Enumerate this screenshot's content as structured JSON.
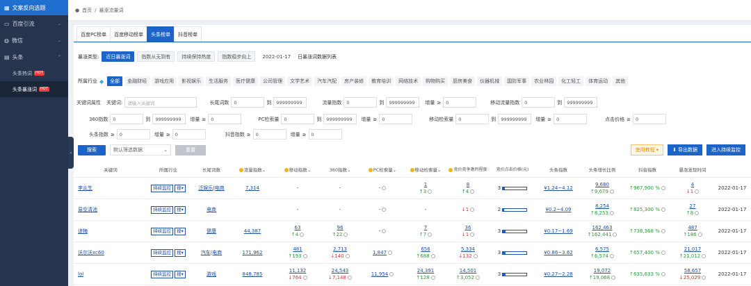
{
  "sidebar": {
    "title": "文案反向选题",
    "items": [
      {
        "label": "百度引流",
        "icon": "monitor-icon"
      },
      {
        "label": "微信",
        "icon": "wechat-icon"
      },
      {
        "label": "头条",
        "icon": "news-icon"
      }
    ],
    "subitems": [
      {
        "label": "头条热词",
        "badge": "HOT"
      },
      {
        "label": "头条暴涨词",
        "badge": "HOT"
      }
    ]
  },
  "breadcrumb": {
    "home": "首页",
    "sep": "/",
    "current": "暴涨流量词"
  },
  "tabs": [
    "百度PC榜单",
    "百度移动榜单",
    "头条榜单",
    "抖音榜单"
  ],
  "type_row": {
    "label": "暴涨类型:",
    "options": [
      "近日暴涨词",
      "指数从无到有",
      "持续保持热度",
      "指数稳步向上"
    ],
    "date": "2022-01-17",
    "date_suffix": "日暴涨词数据列表"
  },
  "industry": {
    "label": "所属行业",
    "items": [
      "全部",
      "金融财经",
      "游戏应用",
      "影视娱乐",
      "生活服务",
      "医疗健康",
      "公司管理",
      "文学艺术",
      "汽车汽配",
      "房产装修",
      "教育培训",
      "网络技术",
      "购物购买",
      "厨房美食",
      "仪器机械",
      "国防军事",
      "农业林园",
      "化工轻工",
      "体育运动",
      "其他"
    ]
  },
  "filters": {
    "kw_property": "关键词属性",
    "keyword_label": "关键词:",
    "keyword_ph": "请输入关键词",
    "to": "到",
    "ge": "≥",
    "long_tail": {
      "label": "长尾词数",
      "min": "0",
      "max": "999999999"
    },
    "traffic": {
      "label": "流量指数",
      "min": "0",
      "max": "999999999"
    },
    "traffic_inc": {
      "label": "增量",
      "value": "0"
    },
    "mobile_traffic": {
      "label": "移动流量指数",
      "min": "0",
      "max": "999999999"
    },
    "i360": {
      "label": "360指数",
      "min": "0",
      "max": "999999999"
    },
    "i360_inc": {
      "label": "增量",
      "value": "0"
    },
    "pc": {
      "label": "PC检索量",
      "min": "0",
      "max": "999999999"
    },
    "pc_inc": {
      "label": "增量",
      "value": "0"
    },
    "mobile": {
      "label": "移动检索量",
      "min": "0",
      "max": "999999999"
    },
    "mobile_inc": {
      "label": "增量",
      "value": "0"
    },
    "click_price": {
      "label": "点击价格",
      "value": "0"
    },
    "tt": {
      "label": "头条指数",
      "value": "0"
    },
    "tt_inc": {
      "label": "增量",
      "value": "0"
    },
    "dy": {
      "label": "抖音指数",
      "value": "0"
    },
    "dy_inc": {
      "label": "增量",
      "value": "0"
    }
  },
  "search": {
    "button": "搜索",
    "select": "默认筛选数据",
    "reset": "重置",
    "tutorial": "使用教程",
    "export": "导出数据",
    "monitor": "进入持续监控"
  },
  "columns": [
    "关键词",
    "所属行业",
    "长尾词数",
    "流量指数",
    "移动指数",
    "360指数",
    "PC检索量",
    "移动检索量",
    "竞价竞争激烈程度",
    "竞价点击价格(元)",
    "头条指数",
    "头条增长比例",
    "抖音指数",
    "暴涨发现时间"
  ],
  "row_btns": {
    "monitor": "持续监控",
    "search": "搜"
  },
  "rows": [
    {
      "kw": "李炎生",
      "ind": "泛娱乐|电商",
      "lt": "7,314",
      "fl": "-",
      "flc": "",
      "fld": "",
      "mb": "-",
      "mbc": "",
      "mbd": "",
      "i360": "-",
      "pc": "1",
      "pcc": "3",
      "pcd": "up",
      "mv": "8",
      "mvc": "4",
      "mvd": "up",
      "lvl": "3",
      "level": 0.08,
      "price": "¥1.24~4.12",
      "tt": "9,680",
      "ttc": "9,679",
      "ttd": "up",
      "rate": "967,900 %",
      "rated": "up",
      "dy": "4",
      "dyc": "1",
      "dyd": "dn",
      "date": "2022-01-17"
    },
    {
      "kw": "易空清池",
      "ind": "电商",
      "lt": "",
      "fl": "-",
      "flc": "",
      "fld": "",
      "mb": "-",
      "mbc": "",
      "mbd": "",
      "i360": "-",
      "pc": "-",
      "pcc": "",
      "pcd": "",
      "mv": "",
      "mvc": "1",
      "mvd": "dn",
      "lvl": "2",
      "level": 0.05,
      "price": "¥0.2~4.09",
      "tt": "8,254",
      "ttc": "8,253",
      "ttd": "up",
      "rate": "825,300 %",
      "rated": "up",
      "dy": "27",
      "dyc": "8",
      "dyd": "up",
      "date": "2022-01-17"
    },
    {
      "kw": "谅梅",
      "ind": "健康",
      "lt": "44,387",
      "fl": "63",
      "flc": "4",
      "fld": "up",
      "mb": "96",
      "mbc": "22",
      "mbd": "up",
      "i360": "-",
      "pc": "7",
      "pcc": "7",
      "pcd": "up",
      "mv": "36",
      "mvc": "1",
      "mvd": "dn",
      "lvl": "3",
      "level": 0.1,
      "price": "¥0.17~1.69",
      "tt": "162,463",
      "ttc": "162,441",
      "ttd": "up",
      "rate": "738,368 %",
      "rated": "up",
      "dy": "487",
      "dyc": "186",
      "dyd": "up",
      "date": "2022-01-17"
    },
    {
      "kw": "沃尔沃xc60",
      "ind": "汽车|电商",
      "lt": "171,962",
      "fl": "481",
      "flc": "193",
      "fld": "up",
      "mb": "2,713",
      "mbc": "140",
      "mbd": "dn",
      "i360": "1,847",
      "pc": "656",
      "pcc": "688",
      "pcd": "up",
      "mv": "5,334",
      "mvc": "132",
      "mvd": "dn",
      "lvl": "3",
      "level": 0.12,
      "price": "¥0.86~3.62",
      "tt": "6,575",
      "ttc": "6,574",
      "ttd": "up",
      "rate": "657,400 %",
      "rated": "up",
      "dy": "21,017",
      "dyc": "21,012",
      "dyd": "up",
      "date": "2022-01-17"
    },
    {
      "kw": "lol",
      "ind": "游戏",
      "lt": "848,785",
      "fl": "11,132",
      "flc": "764",
      "fld": "dn",
      "mb": "24,543",
      "mbc": "7,148",
      "mbd": "dn",
      "i360": "11,954",
      "pc": "24,391",
      "pcc": "128",
      "pcd": "up",
      "mv": "14,501",
      "mvc": "3,052",
      "mvd": "up",
      "lvl": "3",
      "level": 0.1,
      "price": "¥0.27~2.28",
      "tt": "19,072",
      "ttc": "19,068",
      "ttd": "up",
      "rate": "635,633 %",
      "rated": "up",
      "dy": "58,657",
      "dyc": "25,029",
      "dyd": "dn",
      "date": "2022-01-17"
    }
  ]
}
